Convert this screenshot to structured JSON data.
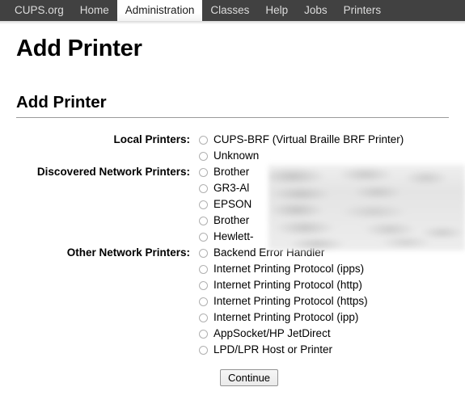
{
  "nav": {
    "items": [
      {
        "label": "CUPS.org",
        "active": false
      },
      {
        "label": "Home",
        "active": false
      },
      {
        "label": "Administration",
        "active": true
      },
      {
        "label": "Classes",
        "active": false
      },
      {
        "label": "Help",
        "active": false
      },
      {
        "label": "Jobs",
        "active": false
      },
      {
        "label": "Printers",
        "active": false
      }
    ]
  },
  "page": {
    "title": "Add Printer",
    "section_title": "Add Printer"
  },
  "form": {
    "groups": [
      {
        "label": "Local Printers:",
        "options": [
          {
            "label": "CUPS-BRF (Virtual Braille BRF Printer)",
            "selected": false
          },
          {
            "label": "Unknown",
            "selected": false
          }
        ]
      },
      {
        "label": "Discovered Network Printers:",
        "redacted": true,
        "options": [
          {
            "label": "Brother",
            "selected": false
          },
          {
            "label": "GR3-Al",
            "selected": false
          },
          {
            "label": "EPSON",
            "selected": false
          },
          {
            "label": "Brother",
            "selected": false
          },
          {
            "label": "Hewlett-",
            "selected": false
          }
        ]
      },
      {
        "label": "Other Network Printers:",
        "options": [
          {
            "label": "Backend Error Handler",
            "selected": false
          },
          {
            "label": "Internet Printing Protocol (ipps)",
            "selected": false
          },
          {
            "label": "Internet Printing Protocol (http)",
            "selected": false
          },
          {
            "label": "Internet Printing Protocol (https)",
            "selected": false
          },
          {
            "label": "Internet Printing Protocol (ipp)",
            "selected": false
          },
          {
            "label": "AppSocket/HP JetDirect",
            "selected": false
          },
          {
            "label": "LPD/LPR Host or Printer",
            "selected": false
          }
        ]
      }
    ],
    "continue_label": "Continue"
  },
  "colors": {
    "nav_background": "#414141",
    "nav_text": "#dcdcdc",
    "active_tab_background": "#ffffff",
    "active_tab_text": "#1a1a1a",
    "rule": "#9a9a9a"
  }
}
